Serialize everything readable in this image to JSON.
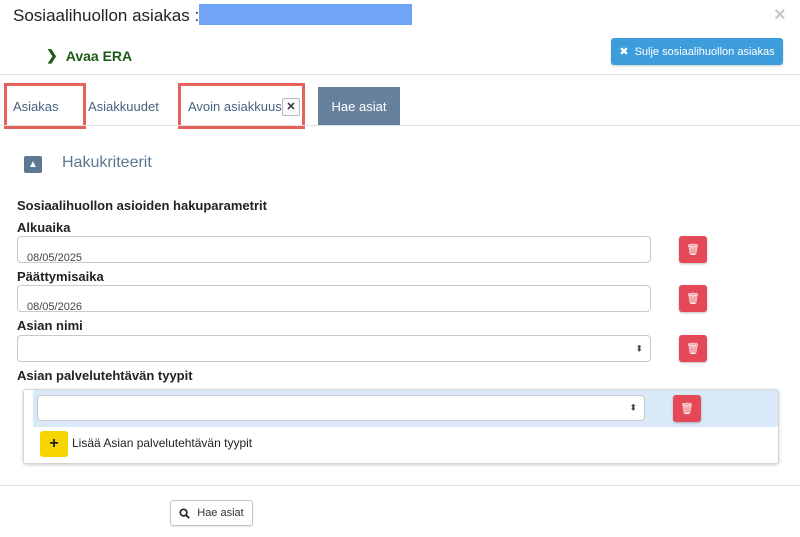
{
  "dialog": {
    "title": "Sosiaalihuollon asiakas :",
    "close_icon": "×"
  },
  "header": {
    "open_era_label": "Avaa ERA",
    "close_client_label": "Sulje sosiaalihuollon asiakas"
  },
  "tabs": [
    {
      "label": "Asiakas"
    },
    {
      "label": "Asiakkuudet"
    },
    {
      "label": "Avoin asiakkuus"
    },
    {
      "label": "Hae asiat"
    }
  ],
  "criteria": {
    "section_title": "Hakukriteerit",
    "subtitle": "Sosiaalihuollon asioiden hakuparametrit",
    "start_label": "Alkuaika",
    "start_value": "08/05/2025",
    "end_label": "Päättymisaika",
    "end_value": "08/05/2026",
    "case_name_label": "Asian nimi",
    "case_name_value": "",
    "service_types_label": "Asian palvelutehtävän tyypit",
    "service_types_value": "",
    "add_service_type_label": "Lisää Asian palvelutehtävän tyypit"
  },
  "footer": {
    "search_button_label": "Hae asiat"
  },
  "colors": {
    "primary": "#3d9ddb",
    "danger": "#e54856",
    "warning": "#f7d500",
    "highlight": "#e5625b",
    "tab_active": "#67819c"
  }
}
